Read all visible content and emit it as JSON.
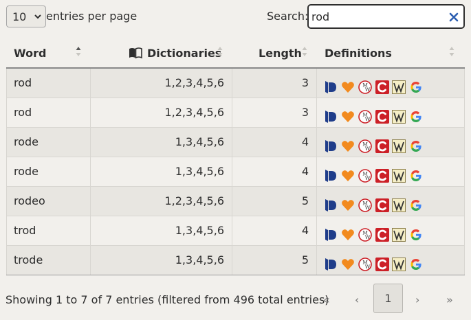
{
  "controls": {
    "page_length": "10",
    "page_length_suffix": "entries per page",
    "search_label": "Search:",
    "search_value": "rod"
  },
  "table": {
    "headers": {
      "word": "Word",
      "dictionaries": "Dictionaries",
      "length": "Length",
      "definitions": "Definitions"
    },
    "definition_icons": [
      "dictionary-d-icon",
      "heart-icon",
      "merriam-webster-icon",
      "collins-c-icon",
      "wiktionary-w-icon",
      "google-g-icon"
    ],
    "rows": [
      {
        "word": "rod",
        "dictionaries": "1,2,3,4,5,6",
        "length": "3"
      },
      {
        "word": "rod",
        "dictionaries": "1,2,3,4,5,6",
        "length": "3"
      },
      {
        "word": "rode",
        "dictionaries": "1,3,4,5,6",
        "length": "4"
      },
      {
        "word": "rode",
        "dictionaries": "1,3,4,5,6",
        "length": "4"
      },
      {
        "word": "rodeo",
        "dictionaries": "1,2,3,4,5,6",
        "length": "5"
      },
      {
        "word": "trod",
        "dictionaries": "1,3,4,5,6",
        "length": "4"
      },
      {
        "word": "trode",
        "dictionaries": "1,3,4,5,6",
        "length": "5"
      }
    ]
  },
  "footer": {
    "info": "Showing 1 to 7 of 7 entries (filtered from 496 total entries)",
    "first": "«",
    "prev": "‹",
    "current": "1",
    "next": "›",
    "last": "»"
  },
  "colors": {
    "accent_blue": "#1f3d8a",
    "heart_orange": "#f28a1e",
    "collins_red": "#cc2027",
    "google_blue": "#4285f4"
  }
}
